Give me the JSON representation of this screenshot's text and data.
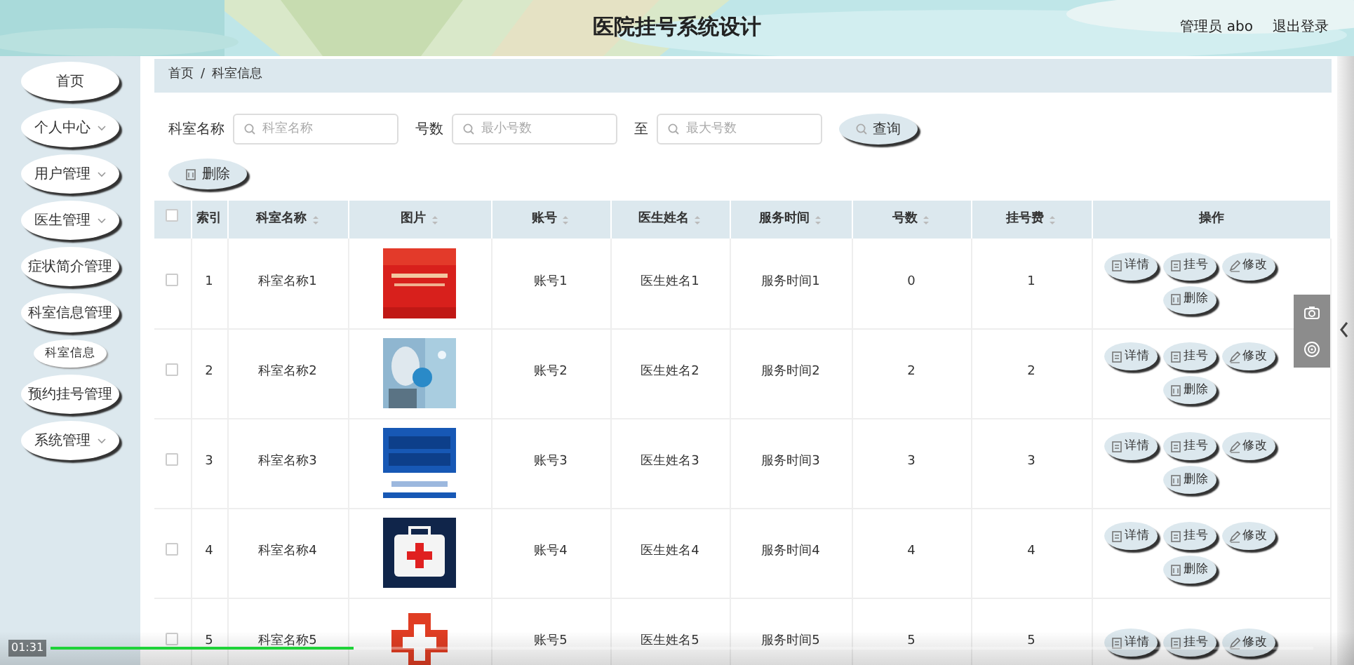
{
  "header": {
    "title": "医院挂号系统设计",
    "user": "管理员 abo",
    "logout": "退出登录"
  },
  "sidebar": {
    "items": [
      {
        "label": "首页",
        "caret": false
      },
      {
        "label": "个人中心",
        "caret": true
      },
      {
        "label": "用户管理",
        "caret": true
      },
      {
        "label": "医生管理",
        "caret": true
      },
      {
        "label": "症状简介管理",
        "caret": false
      },
      {
        "label": "科室信息管理",
        "caret": false,
        "children": [
          {
            "label": "科室信息"
          }
        ]
      },
      {
        "label": "预约挂号管理",
        "caret": false
      },
      {
        "label": "系统管理",
        "caret": true
      }
    ]
  },
  "breadcrumb": {
    "separator": "/",
    "items": [
      "首页",
      "科室信息"
    ]
  },
  "search": {
    "fields": [
      {
        "label": "科室名称",
        "placeholder": "科室名称"
      },
      {
        "label": "号数",
        "placeholder": "最小号数"
      },
      {
        "label": "至",
        "placeholder": "最大号数"
      }
    ],
    "button": "查询"
  },
  "toolbar": {
    "delete": "删除"
  },
  "table": {
    "select_all": {
      "checked": false
    },
    "columns": [
      {
        "label": "索引",
        "sortable": false
      },
      {
        "label": "科室名称",
        "sortable": true
      },
      {
        "label": "图片",
        "sortable": true
      },
      {
        "label": "账号",
        "sortable": true
      },
      {
        "label": "医生姓名",
        "sortable": true
      },
      {
        "label": "服务时间",
        "sortable": true
      },
      {
        "label": "号数",
        "sortable": true
      },
      {
        "label": "挂号费",
        "sortable": true
      },
      {
        "label": "操作",
        "sortable": false
      }
    ],
    "rows": [
      {
        "checked": false,
        "cells": [
          "1",
          "科室名称1",
          {
            "kind": "picture"
          },
          "账号1",
          "医生姓名1",
          "服务时间1",
          "0",
          "1"
        ],
        "actions": [
          {
            "kind": "doc",
            "label": "详情"
          },
          {
            "kind": "doc",
            "label": "挂号"
          },
          {
            "kind": "edit",
            "label": "修改"
          },
          {
            "kind": "delete",
            "label": "删除"
          }
        ]
      },
      {
        "checked": false,
        "cells": [
          "2",
          "科室名称2",
          {
            "kind": "picture"
          },
          "账号2",
          "医生姓名2",
          "服务时间2",
          "2",
          "2"
        ],
        "actions": [
          {
            "kind": "doc",
            "label": "详情"
          },
          {
            "kind": "doc",
            "label": "挂号"
          },
          {
            "kind": "edit",
            "label": "修改"
          },
          {
            "kind": "delete",
            "label": "删除"
          }
        ]
      },
      {
        "checked": false,
        "cells": [
          "3",
          "科室名称3",
          {
            "kind": "picture"
          },
          "账号3",
          "医生姓名3",
          "服务时间3",
          "3",
          "3"
        ],
        "actions": [
          {
            "kind": "doc",
            "label": "详情"
          },
          {
            "kind": "doc",
            "label": "挂号"
          },
          {
            "kind": "edit",
            "label": "修改"
          },
          {
            "kind": "delete",
            "label": "删除"
          }
        ]
      },
      {
        "checked": false,
        "cells": [
          "4",
          "科室名称4",
          {
            "kind": "picture"
          },
          "账号4",
          "医生姓名4",
          "服务时间4",
          "4",
          "4"
        ],
        "actions": [
          {
            "kind": "doc",
            "label": "详情"
          },
          {
            "kind": "doc",
            "label": "挂号"
          },
          {
            "kind": "edit",
            "label": "修改"
          },
          {
            "kind": "delete",
            "label": "删除"
          }
        ]
      },
      {
        "checked": false,
        "cells": [
          "5",
          "科室名称5",
          {
            "kind": "picture"
          },
          "账号5",
          "医生姓名5",
          "服务时间5",
          "5",
          "5"
        ],
        "actions": [
          {
            "kind": "doc",
            "label": "详情"
          },
          {
            "kind": "doc",
            "label": "挂号"
          },
          {
            "kind": "edit",
            "label": "修改"
          }
        ]
      }
    ]
  },
  "player": {
    "time": "01:31",
    "level": 0.24
  }
}
